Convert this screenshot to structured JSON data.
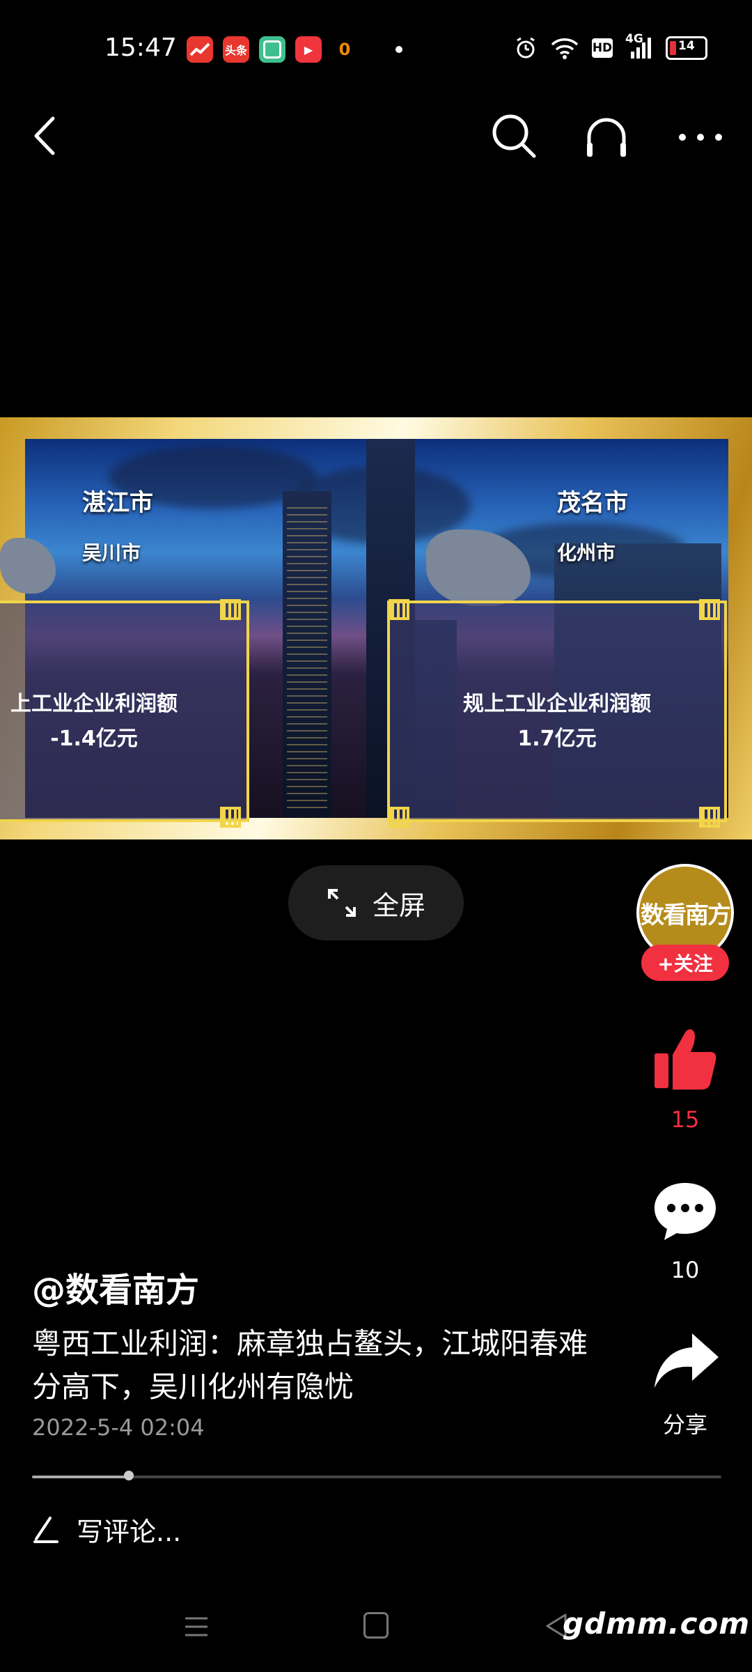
{
  "status_bar": {
    "time": "15:47",
    "apps": [
      {
        "name": "stock-app-icon",
        "label": "",
        "color": "#e8372f"
      },
      {
        "name": "toutiao-app-icon",
        "label": "头条",
        "color": "#e8372f"
      },
      {
        "name": "green-app-icon",
        "label": "",
        "color": "#3fbf8f"
      },
      {
        "name": "video-app-icon",
        "label": "▶",
        "color": "#f0353d"
      },
      {
        "name": "orange-app-icon",
        "label": "0",
        "color": "#f08a00"
      }
    ],
    "hd_label": "HD",
    "network_label": "4G",
    "battery": "14"
  },
  "video": {
    "left_city": "湛江市",
    "left_county": "吴川市",
    "left_metric": "上工业企业利润额",
    "left_value": "-1.4亿元",
    "right_city": "茂名市",
    "right_county": "化州市",
    "right_metric": "规上工业企业利润额",
    "right_value": "1.7亿元"
  },
  "fullscreen_label": "全屏",
  "author": {
    "avatar_text": "数看南方",
    "follow_label": "+关注",
    "handle": "@数看南方"
  },
  "actions": {
    "like_count": "15",
    "comment_count": "10",
    "share_label": "分享"
  },
  "post": {
    "caption": "粤西工业利润：麻章独占鳌头，江城阳春难分高下，吴川化州有隐忧",
    "date": "2022-5-4 02:04",
    "progress": 0.14
  },
  "comment_placeholder": "写评论...",
  "watermark": "gdmm.com"
}
